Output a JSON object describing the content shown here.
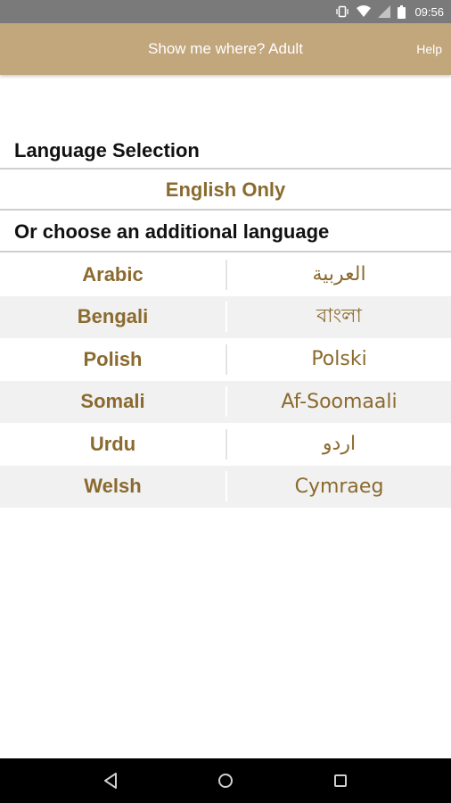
{
  "status_bar": {
    "time": "09:56"
  },
  "app_bar": {
    "title": "Show me where? Adult",
    "help_label": "Help"
  },
  "language_selection": {
    "heading": "Language Selection",
    "english_only": "English Only"
  },
  "additional": {
    "heading": "Or choose an additional language",
    "languages": [
      {
        "name": "Arabic",
        "native": "العربية"
      },
      {
        "name": "Bengali",
        "native": "বাংলা"
      },
      {
        "name": "Polish",
        "native": "Polski"
      },
      {
        "name": "Somali",
        "native": "Af-Soomaali"
      },
      {
        "name": "Urdu",
        "native": "اردو"
      },
      {
        "name": "Welsh",
        "native": "Cymraeg"
      }
    ]
  },
  "colors": {
    "app_bar": "#c2a67c",
    "accent_text": "#8a6a2e",
    "row_alt": "#f1f1f1"
  },
  "icons": [
    "vibrate-icon",
    "wifi-icon",
    "signal-icon",
    "battery-icon",
    "back-icon",
    "home-icon",
    "recents-icon"
  ]
}
